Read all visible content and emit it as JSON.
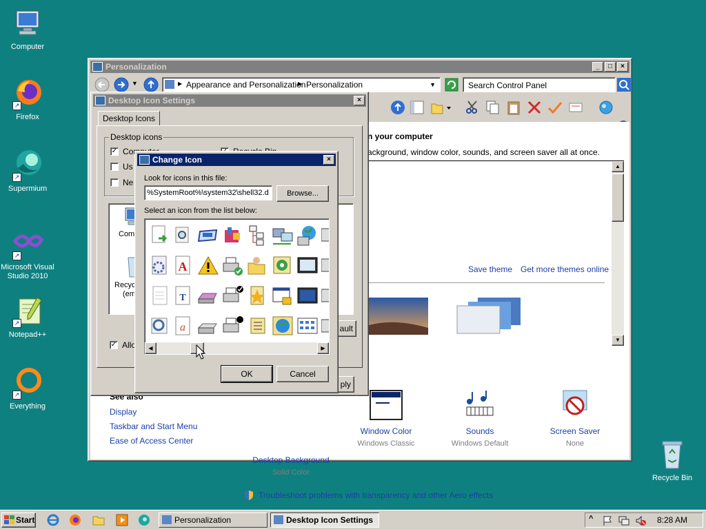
{
  "desktop": {
    "icons": [
      {
        "label": "Computer"
      },
      {
        "label": "Firefox"
      },
      {
        "label": "Supermium"
      },
      {
        "label": "Microsoft Visual Studio 2010"
      },
      {
        "label": "Notepad++"
      },
      {
        "label": "Everything"
      },
      {
        "label": "Recycle Bin"
      }
    ]
  },
  "personalization": {
    "title": "Personalization",
    "breadcrumb": [
      "Appearance and Personalization",
      "Personalization"
    ],
    "search_placeholder": "Search Control Panel",
    "heading": "n your computer",
    "subtitle": "ackground, window color, sounds, and screen saver all at once.",
    "save_theme": "Save theme",
    "get_more_themes": "Get more themes online",
    "see_also": "See also",
    "links": [
      "Display",
      "Taskbar and Start Menu",
      "Ease of Access Center"
    ],
    "settings": [
      {
        "label": "Desktop Background",
        "value": "Solid Color"
      },
      {
        "label": "Window Color",
        "value": "Windows Classic"
      },
      {
        "label": "Sounds",
        "value": "Windows Default"
      },
      {
        "label": "Screen Saver",
        "value": "None"
      }
    ],
    "troubleshoot": "Troubleshoot problems with transparency and other Aero effects"
  },
  "desktop_icon_settings": {
    "title": "Desktop Icon Settings",
    "tab": "Desktop Icons",
    "group_label": "Desktop icons",
    "checkboxes": [
      {
        "label": "Computer",
        "checked": true
      },
      {
        "label": "Recycle Bin",
        "checked": true
      },
      {
        "label": "Us",
        "checked": false
      },
      {
        "label": "Ne",
        "checked": false
      }
    ],
    "preview_labels": [
      "Compu",
      "Recyc",
      "(em"
    ],
    "allow_label": "Allow",
    "allow_checked": true,
    "default_btn": "ault",
    "apply_btn": "ply"
  },
  "change_icon": {
    "title": "Change Icon",
    "look_label": "Look for icons in this file:",
    "path_value": "%SystemRoot%\\system32\\shell32.d",
    "browse": "Browse...",
    "select_label": "Select an icon from the list below:",
    "ok": "OK",
    "cancel": "Cancel"
  },
  "taskbar": {
    "start": "Start",
    "tasks": [
      {
        "label": "Personalization",
        "active": false
      },
      {
        "label": "Desktop Icon Settings",
        "active": true
      }
    ],
    "clock": "8:28 AM"
  }
}
